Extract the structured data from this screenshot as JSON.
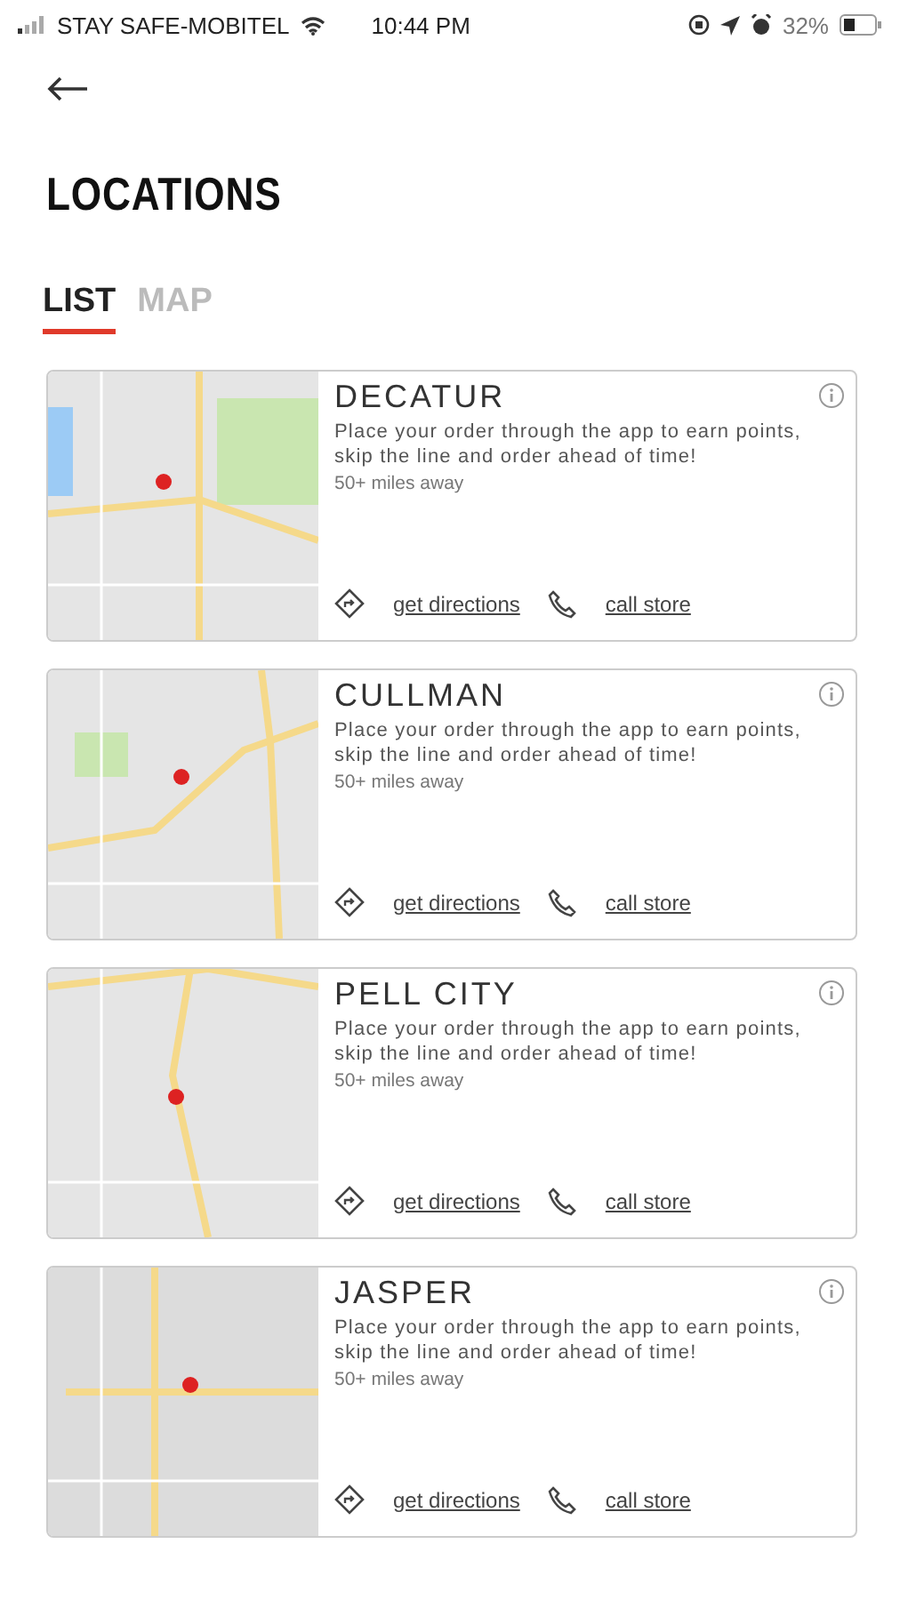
{
  "status_bar": {
    "carrier": "STAY SAFE-MOBITEL",
    "time": "10:44 PM",
    "battery": "32%"
  },
  "title": "LOCATIONS",
  "tabs": [
    {
      "label": "LIST",
      "selected": true
    },
    {
      "label": "MAP",
      "selected": false
    }
  ],
  "locations": [
    {
      "name": "DECATUR",
      "description": "Place your order through the app to earn points, skip the line and order ahead of time!",
      "distance": "50+ miles away",
      "directions": "get directions",
      "call": "call store"
    },
    {
      "name": "CULLMAN",
      "description": "Place your order through the app to earn points, skip the line and order ahead of time!",
      "distance": "50+ miles away",
      "directions": "get directions",
      "call": "call store"
    },
    {
      "name": "PELL CITY",
      "description": "Place your order through the app to earn points, skip the line and order ahead of time!",
      "distance": "50+ miles away",
      "directions": "get directions",
      "call": "call store"
    },
    {
      "name": "JASPER",
      "description": "Place your order through the app to earn points, skip the line and order ahead of time!",
      "distance": "50+ miles away",
      "directions": "get directions",
      "call": "call store"
    }
  ]
}
